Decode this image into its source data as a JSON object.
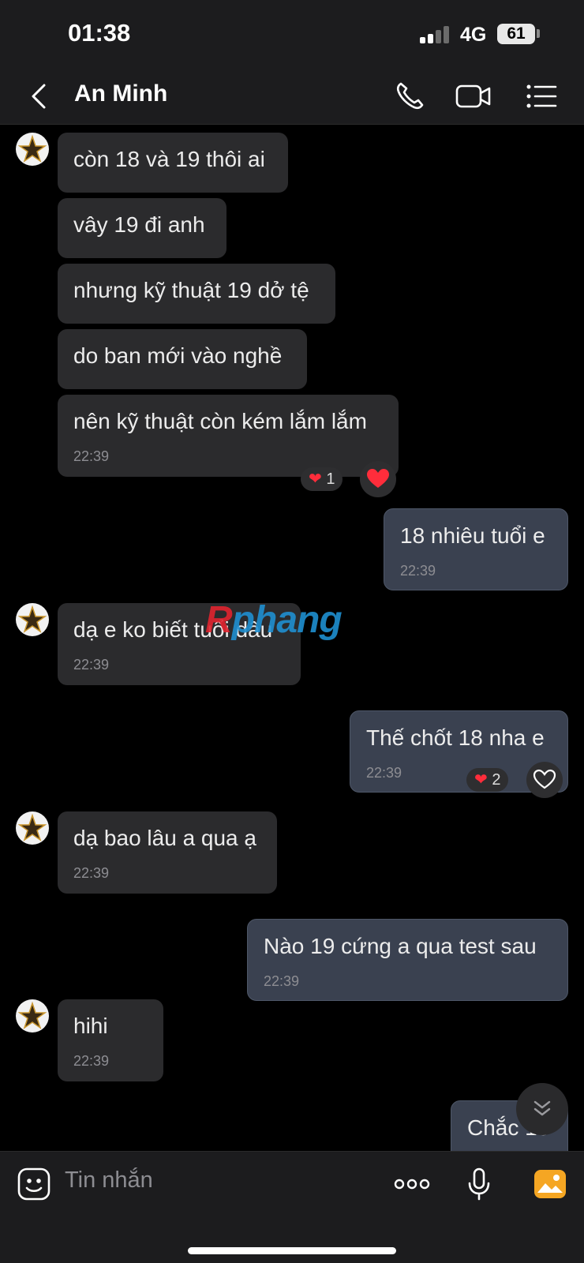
{
  "status": {
    "time": "01:38",
    "network": "4G",
    "battery": "61"
  },
  "header": {
    "contact_name": "An Minh"
  },
  "messages": [
    {
      "dir": "in",
      "text": "còn 18 và 19 thôi ai"
    },
    {
      "dir": "in",
      "text": "vây 19 đi anh"
    },
    {
      "dir": "in",
      "text": "nhưng kỹ thuật 19 dở tệ"
    },
    {
      "dir": "in",
      "text": "do ban mới vào nghề"
    },
    {
      "dir": "in",
      "text": "nên kỹ thuật còn kém lắm lắm",
      "time": "22:39",
      "reaction_count": "1"
    },
    {
      "dir": "out",
      "text": "18 nhiêu tuổi e",
      "time": "22:39"
    },
    {
      "dir": "in",
      "text": "dạ e ko biết tuổi dâu",
      "time": "22:39"
    },
    {
      "dir": "out",
      "text": "Thế chốt 18 nha e",
      "time": "22:39",
      "reaction_count": "2"
    },
    {
      "dir": "in",
      "text": "dạ bao lâu a qua ạ",
      "time": "22:39"
    },
    {
      "dir": "out",
      "text": "Nào 19 cứng a qua test sau",
      "time": "22:39"
    },
    {
      "dir": "in",
      "text": "hihi",
      "time": "22:39"
    },
    {
      "dir": "out",
      "text": "Chắc 15"
    }
  ],
  "watermark": {
    "part1": "R",
    "part2": "phang"
  },
  "composer": {
    "placeholder": "Tin nhắn",
    "more_label": "ooo"
  },
  "colors": {
    "incoming_bubble": "#2b2b2d",
    "outgoing_bubble": "#3a4150",
    "accent": "#f5a623",
    "reaction_heart": "#ff2d3b"
  }
}
